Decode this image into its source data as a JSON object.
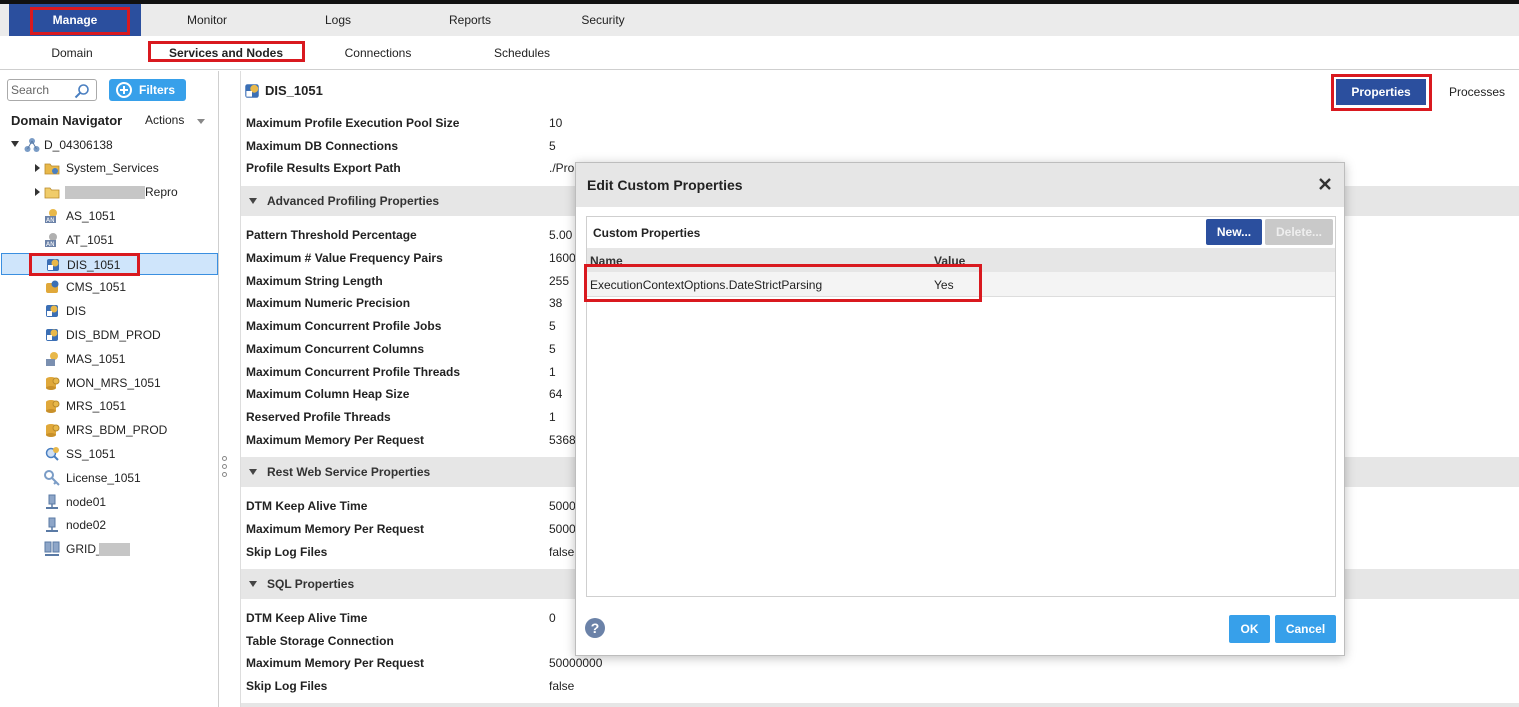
{
  "topnav": {
    "items": [
      {
        "label": "Manage"
      },
      {
        "label": "Monitor"
      },
      {
        "label": "Logs"
      },
      {
        "label": "Reports"
      },
      {
        "label": "Security"
      }
    ]
  },
  "subnav": {
    "items": [
      {
        "label": "Domain"
      },
      {
        "label": "Services and Nodes"
      },
      {
        "label": "Connections"
      },
      {
        "label": "Schedules"
      }
    ]
  },
  "navigator": {
    "search_placeholder": "Search",
    "filters_label": "Filters",
    "title": "Domain Navigator",
    "actions_label": "Actions",
    "tree": [
      {
        "label": "D_04306138"
      },
      {
        "label": "System_Services"
      },
      {
        "label": "Repro"
      },
      {
        "label": "AS_1051"
      },
      {
        "label": "AT_1051"
      },
      {
        "label": "DIS_1051"
      },
      {
        "label": "CMS_1051"
      },
      {
        "label": "DIS"
      },
      {
        "label": "DIS_BDM_PROD"
      },
      {
        "label": "MAS_1051"
      },
      {
        "label": "MON_MRS_1051"
      },
      {
        "label": "MRS_1051"
      },
      {
        "label": "MRS_BDM_PROD"
      },
      {
        "label": "SS_1051"
      },
      {
        "label": "License_1051"
      },
      {
        "label": "node01"
      },
      {
        "label": "node02"
      },
      {
        "label": "GRID_"
      }
    ]
  },
  "main": {
    "service_title": "DIS_1051",
    "tabs": {
      "properties": "Properties",
      "processes": "Processes"
    },
    "general_props": [
      {
        "name": "Maximum Profile Execution Pool Size",
        "value": "10"
      },
      {
        "name": "Maximum DB Connections",
        "value": "5"
      },
      {
        "name": "Profile Results Export Path",
        "value": "./Pro"
      }
    ],
    "sections": [
      {
        "title": "Advanced Profiling Properties"
      },
      {
        "title": "Rest Web Service Properties"
      },
      {
        "title": "SQL Properties"
      }
    ],
    "advanced_profiling": [
      {
        "name": "Pattern Threshold Percentage",
        "value": "5.00"
      },
      {
        "name": "Maximum # Value Frequency Pairs",
        "value": "1600"
      },
      {
        "name": "Maximum String Length",
        "value": "255"
      },
      {
        "name": "Maximum Numeric Precision",
        "value": "38"
      },
      {
        "name": "Maximum Concurrent Profile Jobs",
        "value": "5"
      },
      {
        "name": "Maximum Concurrent Columns",
        "value": "5"
      },
      {
        "name": "Maximum Concurrent Profile Threads",
        "value": "1"
      },
      {
        "name": "Maximum Column Heap Size",
        "value": "64"
      },
      {
        "name": "Reserved Profile Threads",
        "value": "1"
      },
      {
        "name": "Maximum Memory Per Request",
        "value": "5368"
      }
    ],
    "rest_web_service": [
      {
        "name": "DTM Keep Alive Time",
        "value": "5000"
      },
      {
        "name": "Maximum Memory Per Request",
        "value": "5000"
      },
      {
        "name": "Skip Log Files",
        "value": "false"
      }
    ],
    "sql": [
      {
        "name": "DTM Keep Alive Time",
        "value": "0"
      },
      {
        "name": "Table Storage Connection",
        "value": ""
      },
      {
        "name": "Maximum Memory Per Request",
        "value": "50000000"
      },
      {
        "name": "Skip Log Files",
        "value": "false"
      }
    ]
  },
  "dialog": {
    "title": "Edit Custom Properties",
    "panel_title": "Custom Properties",
    "new_label": "New...",
    "delete_label": "Delete...",
    "columns": {
      "name": "Name",
      "value": "Value"
    },
    "rows": [
      {
        "name": "ExecutionContextOptions.DateStrictParsing",
        "value": "Yes"
      }
    ],
    "help_label": "?",
    "ok_label": "OK",
    "cancel_label": "Cancel"
  },
  "colors": {
    "accent_blue": "#2b4f9e",
    "button_blue": "#37a0ea",
    "highlight_red": "#d9191f",
    "selection_bg": "#cfe5fb"
  }
}
